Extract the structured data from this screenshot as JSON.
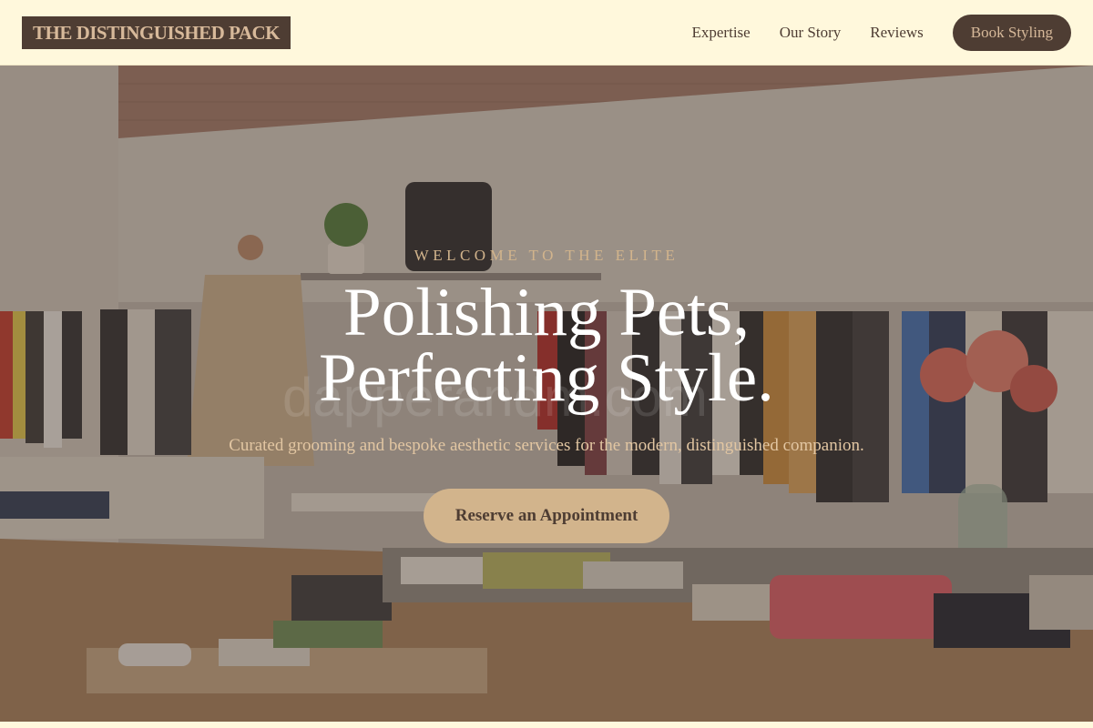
{
  "header": {
    "logo": "THE DISTINGUISHED PACK",
    "nav": [
      {
        "label": "Expertise"
      },
      {
        "label": "Our Story"
      },
      {
        "label": "Reviews"
      }
    ],
    "book_label": "Book Styling"
  },
  "hero": {
    "eyebrow": "WELCOME TO THE ELITE",
    "headline_line1": "Polishing Pets,",
    "headline_line2": "Perfecting Style.",
    "subtext": "Curated grooming and bespoke aesthetic services for the modern, distinguished companion.",
    "cta_label": "Reserve an Appointment",
    "watermark": "dapperandm.com",
    "background_description_icon": "boutique-photo"
  },
  "colors": {
    "brand_dark": "#4e3d33",
    "brand_gold": "#d2b48c",
    "background": "#fff8dc"
  }
}
